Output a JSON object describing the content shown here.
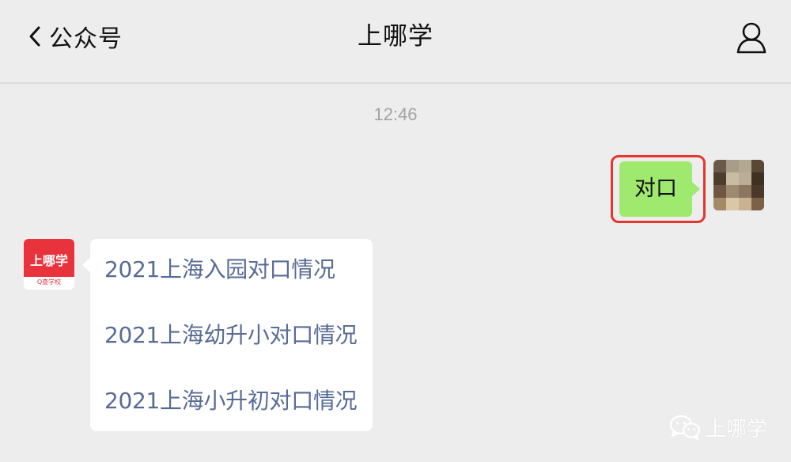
{
  "header": {
    "back_label": "公众号",
    "title": "上哪学",
    "back_icon": "chevron-left-icon",
    "profile_icon": "person-icon"
  },
  "chat": {
    "timestamp": "12:46",
    "outgoing": {
      "text": "对口",
      "bubble_color": "#9fe96f",
      "highlight_color": "#e4362d"
    },
    "incoming": {
      "avatar": {
        "name": "上哪学",
        "subtitle": "Q查学校",
        "brand_color": "#e8323c"
      },
      "links": [
        "2021上海入园对口情况",
        "2021上海幼升小对口情况",
        "2021上海小升初对口情况"
      ],
      "link_color": "#576b95"
    }
  },
  "watermark": {
    "text": "上哪学",
    "icon": "wechat-icon"
  }
}
